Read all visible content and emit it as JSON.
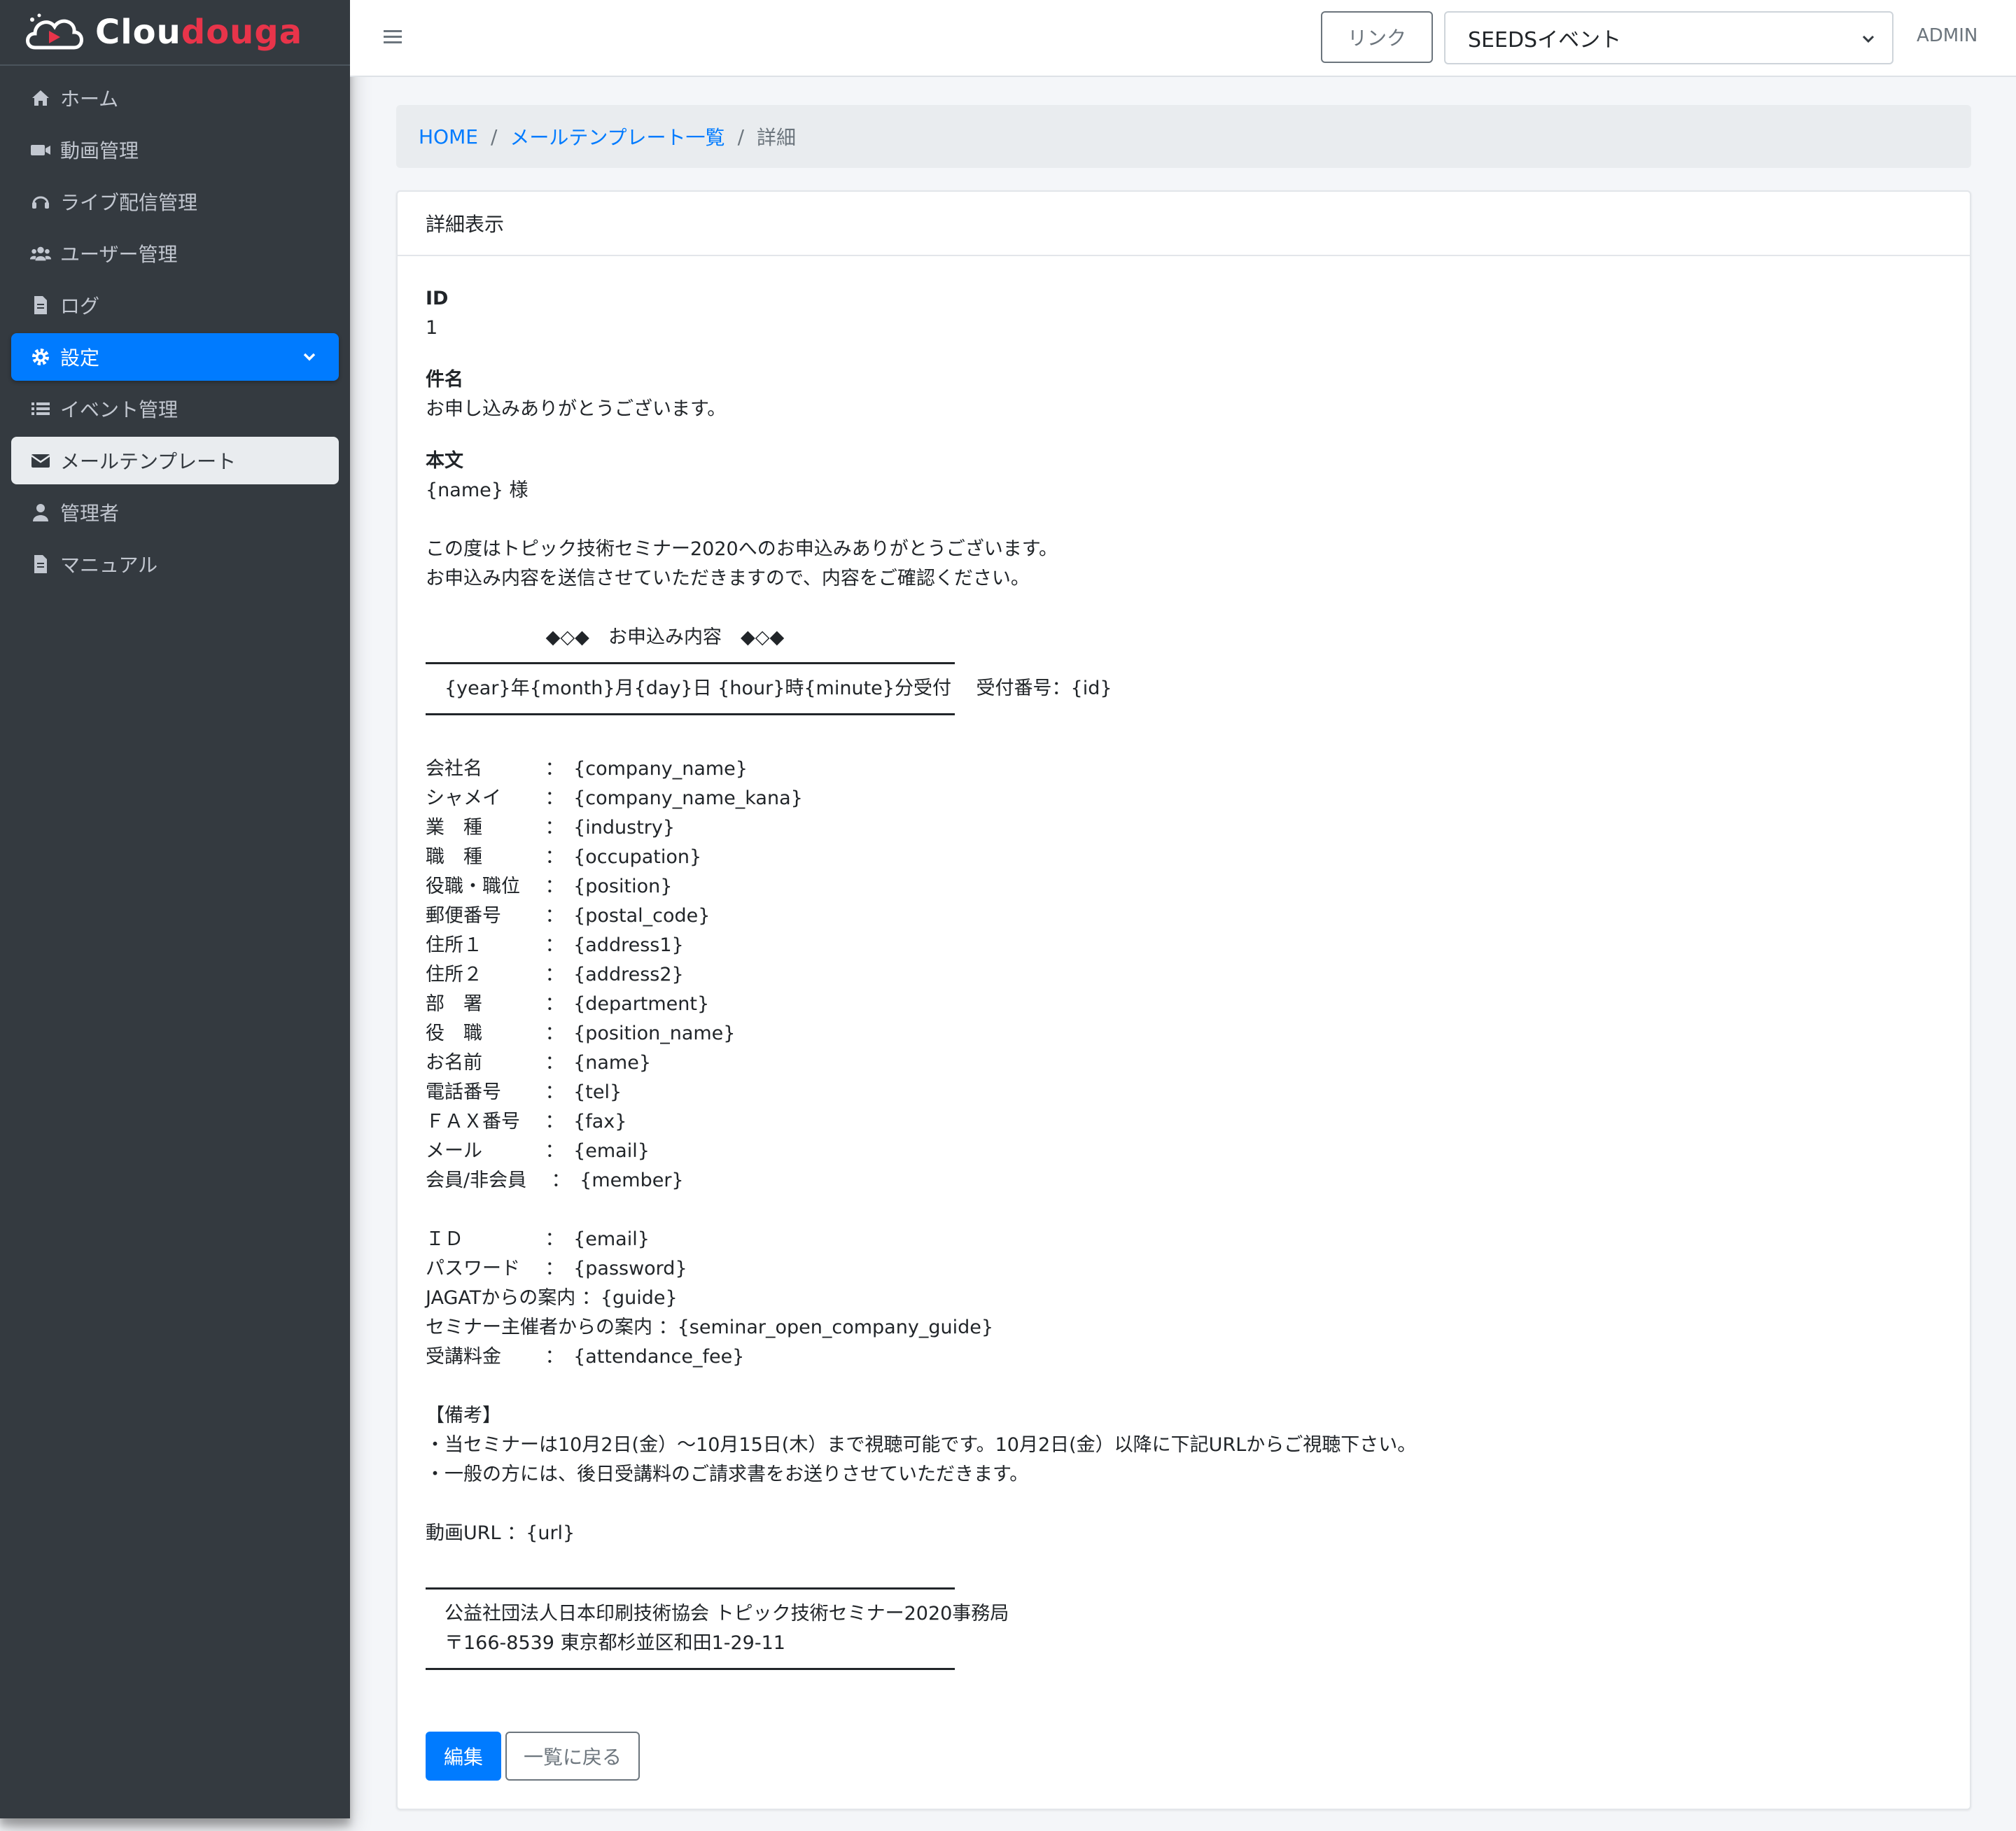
{
  "brand": {
    "name_part1": "Clou",
    "name_part2": "douga"
  },
  "sidebar": {
    "items": [
      {
        "label": "ホーム",
        "icon": "home-icon"
      },
      {
        "label": "動画管理",
        "icon": "video-icon"
      },
      {
        "label": "ライブ配信管理",
        "icon": "headset-icon"
      },
      {
        "label": "ユーザー管理",
        "icon": "users-icon"
      },
      {
        "label": "ログ",
        "icon": "file-icon"
      },
      {
        "label": "設定",
        "icon": "gear-icon"
      },
      {
        "label": "イベント管理",
        "icon": "list-icon"
      },
      {
        "label": "メールテンプレート",
        "icon": "envelope-icon"
      },
      {
        "label": "管理者",
        "icon": "user-icon"
      },
      {
        "label": "マニュアル",
        "icon": "file-icon"
      }
    ]
  },
  "topbar": {
    "link_label": "リンク",
    "event_selected": "SEEDSイベント",
    "admin_label": "ADMIN"
  },
  "breadcrumb": {
    "home": "HOME",
    "list": "メールテンプレート一覧",
    "current": "詳細"
  },
  "card": {
    "header": "詳細表示",
    "id_label": "ID",
    "id_value": "1",
    "subject_label": "件名",
    "subject_value": "お申し込みありがとうございます。",
    "body_label": "本文",
    "body_lines": [
      "{name} 様",
      "",
      "この度はトピック技術セミナー2020へのお申込みありがとうございます。",
      "お申込み内容を送信させていただきますので、内容をご確認ください。",
      "",
      "                    ◆◇◆　お申込み内容　◆◇◆",
      "__HR__",
      "　{year}年{month}月{day}日 {hour}時{minute}分受付　 受付番号：{id}",
      "__HR__",
      "",
      "会社名　　　 ：　{company_name}",
      "シャメイ　　 ：　{company_name_kana}",
      "業　種　　　 ：　{industry}",
      "職　種　　　 ：　{occupation}",
      "役職・職位　 ：　{position}",
      "郵便番号　　 ：　{postal_code}",
      "住所１　　　 ：　{address1}",
      "住所２　　　 ：　{address2}",
      "部　署　　　 ：　{department}",
      "役　職　　　 ：　{position_name}",
      "お名前　　　 ：　{name}",
      "電話番号　　 ：　{tel}",
      "ＦＡＸ番号　 ：　{fax}",
      "メール　　　 ：　{email}",
      "会員/非会員　 ：　{member}",
      "",
      "ＩＤ　　　　 ：　{email}",
      "パスワード　 ：　{password}",
      "JAGATからの案内 ：{guide}",
      "セミナー主催者からの案内 ：{seminar_open_company_guide}",
      "受講料金　　 ：　{attendance_fee}",
      "",
      "【備考】",
      "・当セミナーは10月2日(金）〜10月15日(木）まで視聴可能です。10月2日(金）以降に下記URLからご視聴下さい。",
      "・一般の方には、後日受講料のご請求書をお送りさせていただきます。",
      "",
      "動画URL ：{url}",
      "",
      "__HR__",
      "　公益社団法人日本印刷技術協会 トピック技術セミナー2020事務局",
      "　〒166-8539 東京都杉並区和田1-29-11",
      "__HR__"
    ],
    "edit_label": "編集",
    "back_label": "一覧に戻る"
  },
  "colors": {
    "primary": "#007bff",
    "sidebar_bg": "#343a40",
    "brand_accent": "#e8344a"
  }
}
